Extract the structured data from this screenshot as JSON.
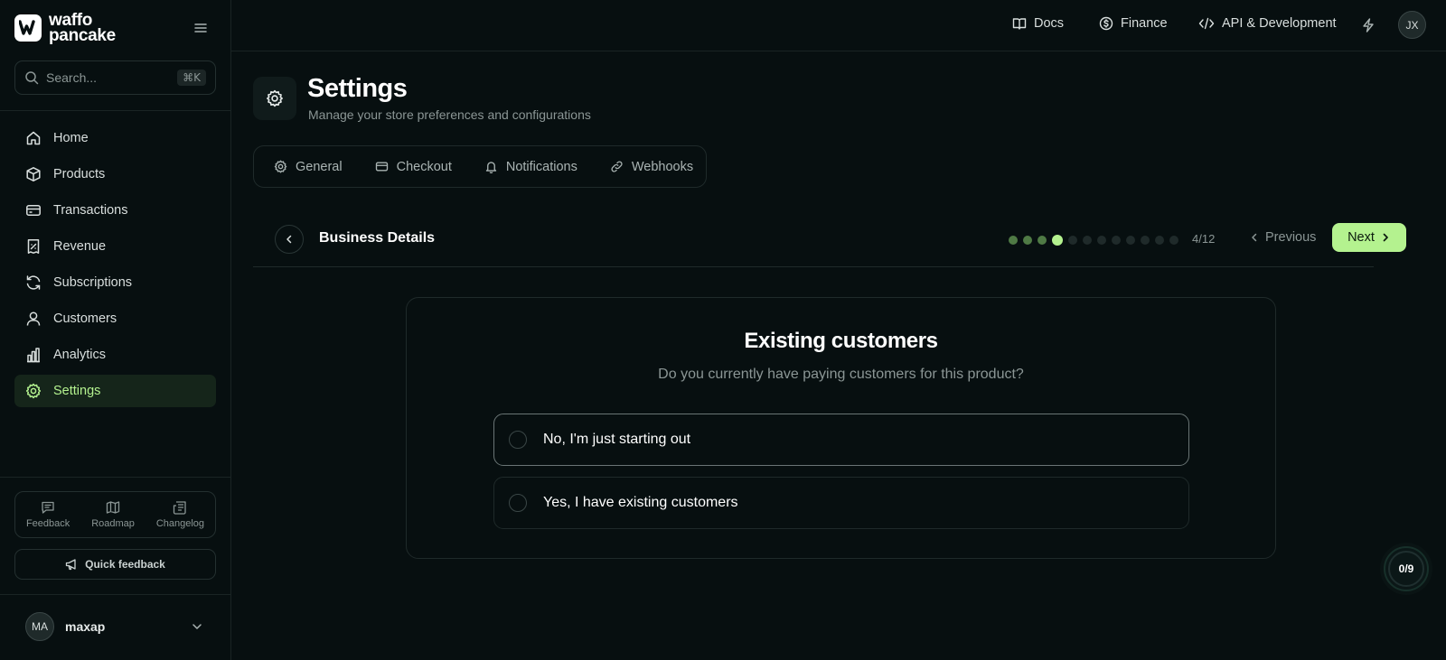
{
  "brand": {
    "name_line1": "waffo",
    "name_line2": "pancake"
  },
  "search": {
    "placeholder": "Search...",
    "shortcut": "⌘K"
  },
  "sidebar": {
    "items": [
      {
        "label": "Home",
        "icon": "home-icon"
      },
      {
        "label": "Products",
        "icon": "box-icon"
      },
      {
        "label": "Transactions",
        "icon": "credit-card-icon"
      },
      {
        "label": "Revenue",
        "icon": "receipt-icon"
      },
      {
        "label": "Subscriptions",
        "icon": "refresh-icon"
      },
      {
        "label": "Customers",
        "icon": "user-icon"
      },
      {
        "label": "Analytics",
        "icon": "bar-chart-icon"
      },
      {
        "label": "Settings",
        "icon": "gear-icon",
        "active": true
      }
    ],
    "footer_links": [
      {
        "label": "Feedback",
        "icon": "message-icon"
      },
      {
        "label": "Roadmap",
        "icon": "map-icon"
      },
      {
        "label": "Changelog",
        "icon": "newspaper-icon"
      }
    ],
    "quick_feedback": "Quick feedback",
    "user": {
      "initials": "MA",
      "name": "maxap"
    }
  },
  "topbar": {
    "links": [
      {
        "label": "Docs",
        "icon": "book-icon"
      },
      {
        "label": "Finance",
        "icon": "dollar-circle-icon"
      },
      {
        "label": "API & Development",
        "icon": "code-icon"
      }
    ],
    "avatar_initials": "JX"
  },
  "page": {
    "title": "Settings",
    "subtitle": "Manage your store preferences and configurations"
  },
  "tabs": [
    {
      "label": "General",
      "icon": "gear-icon"
    },
    {
      "label": "Checkout",
      "icon": "credit-card-icon"
    },
    {
      "label": "Notifications",
      "icon": "bell-icon"
    },
    {
      "label": "Webhooks",
      "icon": "link-icon"
    }
  ],
  "wizard": {
    "section_title": "Business Details",
    "current_step": 4,
    "total_steps": 12,
    "step_count": "4/12",
    "previous_label": "Previous",
    "next_label": "Next"
  },
  "question": {
    "title": "Existing customers",
    "subtitle": "Do you currently have paying customers for this product?",
    "options": [
      {
        "label": "No, I'm just starting out",
        "selected": false
      },
      {
        "label": "Yes, I have existing customers",
        "selected": false
      }
    ]
  },
  "progress_badge": "0/9",
  "colors": {
    "accent": "#b4f28f",
    "background": "#070f10",
    "border": "#1f2a2a",
    "muted": "#8b9695"
  }
}
